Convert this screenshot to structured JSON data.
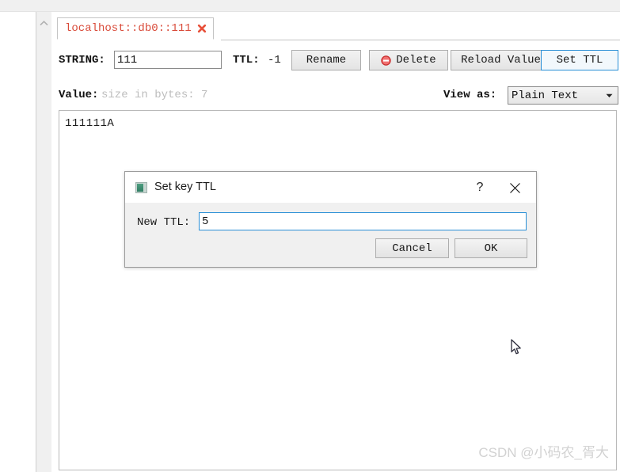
{
  "window": {
    "scrollbar_arrow_icon": "chevron-up-icon"
  },
  "tab": {
    "label": "localhost::db0::111",
    "close_icon": "close-x-icon"
  },
  "toolbar": {
    "type_label": "STRING:",
    "key_value": "111",
    "key_placeholder": "",
    "ttl_label": "TTL:",
    "ttl_value": "-1",
    "rename_label": "Rename",
    "delete_label": "Delete",
    "delete_icon": "delete-circle-icon",
    "reload_label": "Reload Value",
    "set_ttl_label": "Set TTL"
  },
  "value_row": {
    "value_label": "Value:",
    "size_label": "size in bytes: 7",
    "view_as_label": "View as:",
    "view_as_selected": "Plain Text",
    "view_as_caret_icon": "chevron-down-icon",
    "view_as_options": [
      "Plain Text"
    ]
  },
  "value_area": {
    "content": "111111A"
  },
  "dialog": {
    "icon": "app-square-icon",
    "title": "Set key TTL",
    "help_label": "?",
    "close_icon": "close-x-icon",
    "field_label": "New TTL:",
    "field_value": "5",
    "cancel_label": "Cancel",
    "ok_label": "OK"
  },
  "watermark": {
    "text": "CSDN @小码农_胥大"
  },
  "colors": {
    "tab_text": "#d94b3a",
    "focus_border": "#2a8fd6",
    "delete_icon": "#e03a3a",
    "muted_text": "#bdbdbd",
    "watermark": "#d2d2d2"
  }
}
